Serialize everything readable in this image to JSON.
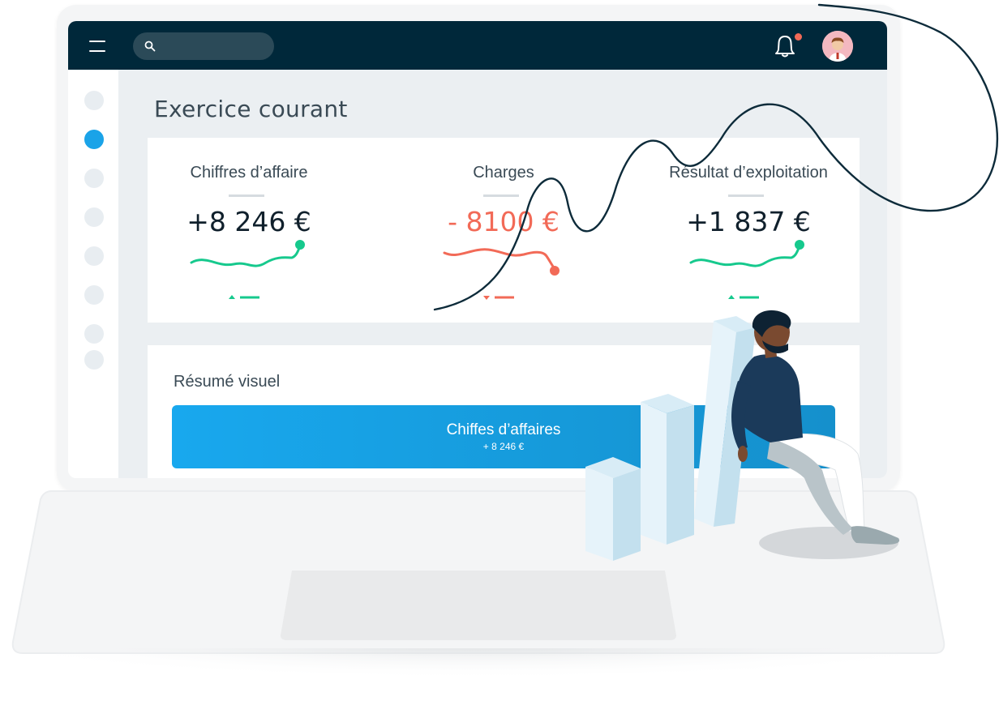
{
  "header": {
    "menu_icon": "hamburger-menu-icon",
    "search_icon": "search-icon",
    "search_placeholder": "",
    "notification_icon": "bell-icon",
    "avatar": "user-avatar"
  },
  "sidebar": {
    "items": [
      {
        "active": false
      },
      {
        "active": true
      },
      {
        "active": false
      },
      {
        "active": false
      },
      {
        "active": false
      },
      {
        "active": false
      },
      {
        "active": false
      },
      {
        "active": false
      }
    ],
    "active_color": "#1aa3e8"
  },
  "main": {
    "title": "Exercice courant",
    "kpis": [
      {
        "label": "Chiffres d’affaire",
        "value": "+8 246 €",
        "trend": "up",
        "color": "#16c98d"
      },
      {
        "label": "Charges",
        "value": "- 8100 €",
        "trend": "down",
        "color": "#f26a57"
      },
      {
        "label": "Résultat d’exploitation",
        "value": "+1 837 €",
        "trend": "up",
        "color": "#16c98d"
      }
    ],
    "summary": {
      "title": "Résumé visuel",
      "bar_label": "Chiffes d’affaires",
      "bar_value": "+ 8 246 €"
    }
  },
  "colors": {
    "topbar": "#00283a",
    "accent": "#1aa3e8",
    "positive": "#16c98d",
    "negative": "#f26a57"
  }
}
